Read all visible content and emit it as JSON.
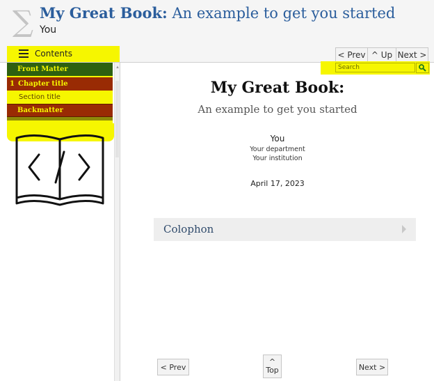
{
  "header": {
    "sigma": "∑",
    "title_main": "My Great Book:",
    "title_sub": "An example to get you started",
    "author": "You"
  },
  "toolbar": {
    "toc_label": "Contents",
    "prev_label": "< Prev",
    "up_label": "^ Up",
    "next_label": "Next >"
  },
  "search": {
    "placeholder": "Search"
  },
  "toc": {
    "items": [
      {
        "number": "",
        "label": "Front Matter"
      },
      {
        "number": "1",
        "label": "Chapter title"
      },
      {
        "number": "",
        "label": "Section title"
      },
      {
        "number": "",
        "label": "Backmatter"
      }
    ]
  },
  "main": {
    "title": "My Great Book:",
    "subtitle": "An example to get you started",
    "author": "You",
    "department": "Your department",
    "institution": "Your institution",
    "date": "April 17, 2023",
    "colophon": "Colophon"
  },
  "bottom_nav": {
    "prev_label": "< Prev",
    "top_arrow": "^",
    "top_label": "Top",
    "next_label": "Next >"
  },
  "colors": {
    "title_blue": "#2a5d9c",
    "highlight_yellow": "#f6f600",
    "front_matter_green": "#2d6010",
    "chapter_red": "#992b04"
  }
}
